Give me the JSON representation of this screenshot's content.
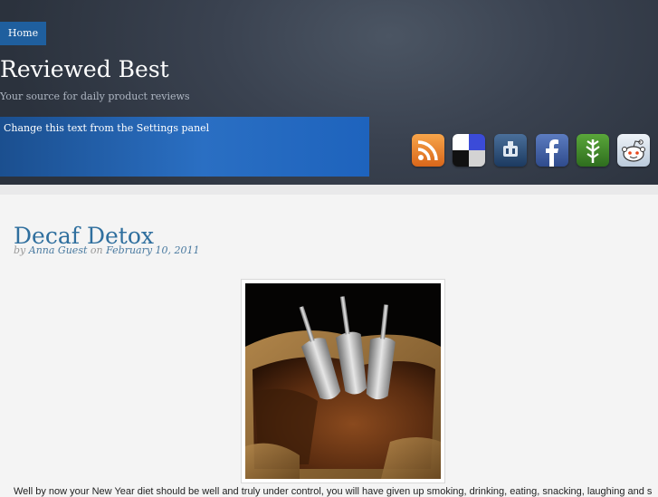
{
  "nav": {
    "home_label": "Home"
  },
  "site": {
    "title": "Reviewed Best",
    "tagline": "Your source for daily product reviews"
  },
  "banner": {
    "text": "Change this text from the Settings panel"
  },
  "social": {
    "icons": [
      "rss-icon",
      "delicious-icon",
      "digg-icon",
      "facebook-icon",
      "evernote-icon",
      "reddit-icon"
    ]
  },
  "post": {
    "title": "Decaf Detox",
    "by_label": "by",
    "author": "Anna Guest",
    "on_label": "on",
    "date": "February 10, 2011",
    "body_excerpt": "Well by now your New Year diet should be well and truly under control, you will have given up smoking, drinking, eating, snacking, laughing and s"
  },
  "colors": {
    "nav_bg": "#1f5f9e",
    "title_link": "#2f6f9e",
    "banner": "#2a6fc3"
  }
}
